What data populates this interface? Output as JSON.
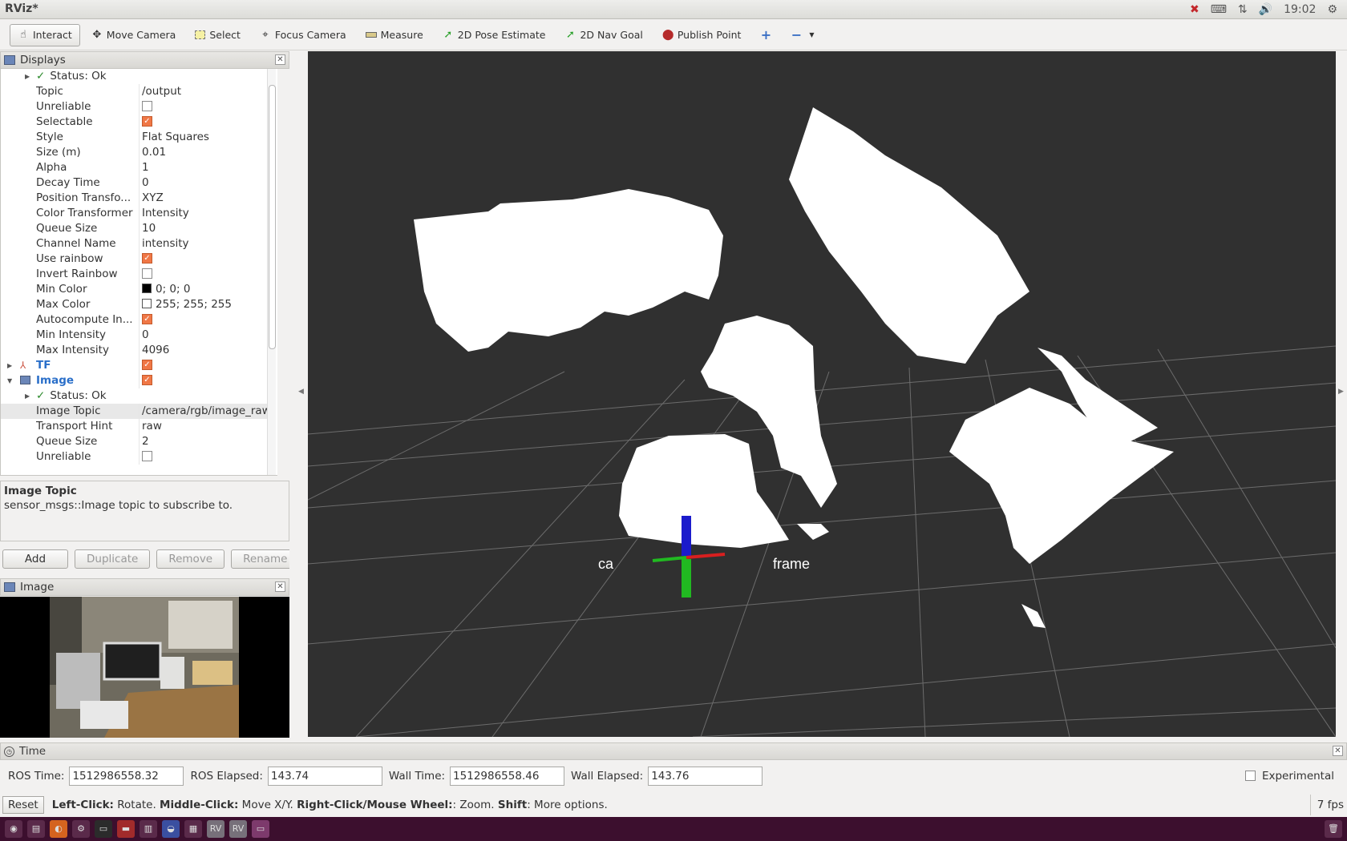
{
  "window": {
    "title": "RViz*"
  },
  "tray": {
    "clock": "19:02"
  },
  "toolbar": {
    "tools": [
      {
        "label": "Interact",
        "icon": "hand-icon"
      },
      {
        "label": "Move Camera",
        "icon": "move-camera-icon"
      },
      {
        "label": "Select",
        "icon": "select-icon"
      },
      {
        "label": "Focus Camera",
        "icon": "focus-camera-icon"
      },
      {
        "label": "Measure",
        "icon": "ruler-icon"
      },
      {
        "label": "2D Pose Estimate",
        "icon": "pose-arrow-icon"
      },
      {
        "label": "2D Nav Goal",
        "icon": "nav-goal-icon"
      },
      {
        "label": "Publish Point",
        "icon": "map-pin-icon"
      }
    ]
  },
  "displays": {
    "title": "Displays",
    "rows": [
      {
        "name": "Status: Ok",
        "value": ""
      },
      {
        "name": "Topic",
        "value": "/output"
      },
      {
        "name": "Unreliable",
        "value": ""
      },
      {
        "name": "Selectable",
        "value": ""
      },
      {
        "name": "Style",
        "value": "Flat Squares"
      },
      {
        "name": "Size (m)",
        "value": "0.01"
      },
      {
        "name": "Alpha",
        "value": "1"
      },
      {
        "name": "Decay Time",
        "value": "0"
      },
      {
        "name": "Position Transfo...",
        "value": "XYZ"
      },
      {
        "name": "Color Transformer",
        "value": "Intensity"
      },
      {
        "name": "Queue Size",
        "value": "10"
      },
      {
        "name": "Channel Name",
        "value": "intensity"
      },
      {
        "name": "Use rainbow",
        "value": ""
      },
      {
        "name": "Invert Rainbow",
        "value": ""
      },
      {
        "name": "Min Color",
        "value": "0; 0; 0"
      },
      {
        "name": "Max Color",
        "value": "255; 255; 255"
      },
      {
        "name": "Autocompute In...",
        "value": ""
      },
      {
        "name": "Min Intensity",
        "value": "0"
      },
      {
        "name": "Max Intensity",
        "value": "4096"
      },
      {
        "name": "TF",
        "value": ""
      },
      {
        "name": "Image",
        "value": ""
      },
      {
        "name": "Status: Ok",
        "value": ""
      },
      {
        "name": "Image Topic",
        "value": "/camera/rgb/image_raw"
      },
      {
        "name": "Transport Hint",
        "value": "raw"
      },
      {
        "name": "Queue Size",
        "value": "2"
      },
      {
        "name": "Unreliable",
        "value": ""
      }
    ],
    "description": {
      "title": "Image Topic",
      "text": "sensor_msgs::Image topic to subscribe to."
    },
    "buttons": {
      "add": "Add",
      "duplicate": "Duplicate",
      "remove": "Remove",
      "rename": "Rename"
    }
  },
  "image_panel": {
    "title": "Image"
  },
  "viewport": {
    "frame_label": "ca",
    "frame_label2": "frame"
  },
  "time": {
    "title": "Time",
    "ros_time_label": "ROS Time:",
    "ros_time": "1512986558.32",
    "ros_elapsed_label": "ROS Elapsed:",
    "ros_elapsed": "143.74",
    "wall_time_label": "Wall Time:",
    "wall_time": "1512986558.46",
    "wall_elapsed_label": "Wall Elapsed:",
    "wall_elapsed": "143.76",
    "experimental": "Experimental"
  },
  "status": {
    "reset": "Reset",
    "left_click": "Left-Click:",
    "left_click_desc": "Rotate.",
    "middle_click": "Middle-Click:",
    "middle_click_desc": "Move X/Y.",
    "right_click": "Right-Click/Mouse Wheel:",
    "right_click_desc": ": Zoom.",
    "shift": "Shift",
    "shift_desc": ": More options.",
    "fps": "7 fps"
  }
}
